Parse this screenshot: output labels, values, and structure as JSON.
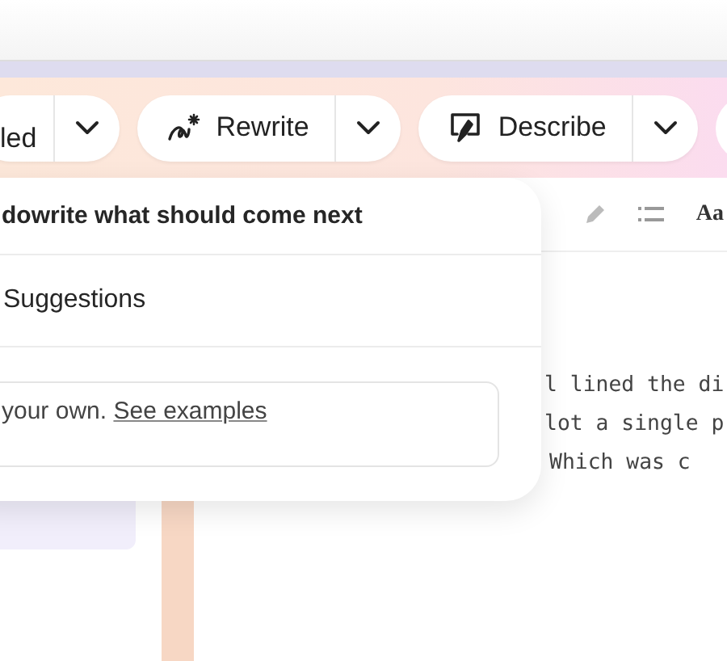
{
  "toolbar": {
    "buttons": [
      {
        "label": "led",
        "kind": "plain"
      },
      {
        "label": "Rewrite",
        "kind": "rewrite"
      },
      {
        "label": "Describe",
        "kind": "describe"
      }
    ]
  },
  "editor": {
    "format_label": "Aa",
    "lines": [
      "l lined the di",
      "lot a single p",
      "Which was c"
    ]
  },
  "popup": {
    "title": "dowrite what should come next",
    "option": "Suggestions",
    "field": {
      "text": "your own.",
      "link": "See examples"
    }
  }
}
